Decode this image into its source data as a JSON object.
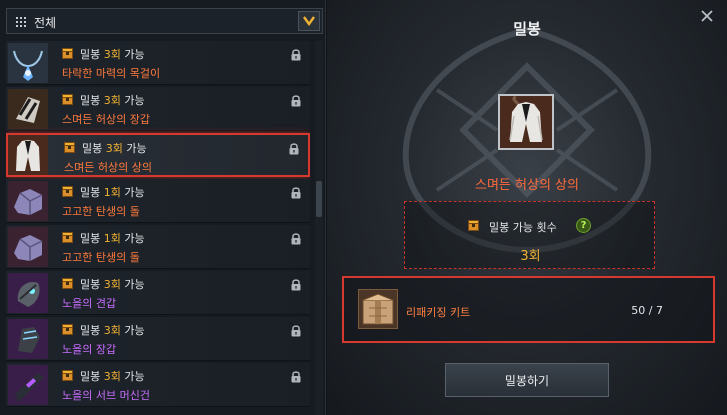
{
  "filter": {
    "label": "전체",
    "icon": "grid-icon",
    "dropdown_icon": "chevron-down-icon",
    "accent": "#f0b232"
  },
  "list": {
    "items": [
      {
        "prefix": "밀봉 ",
        "count": "3회",
        "suffix": " 가능",
        "name": "타락한 마력의 목걸이",
        "name_color": "#ff7a3c",
        "icon": "necklace-icon",
        "selected": false
      },
      {
        "prefix": "밀봉 ",
        "count": "3회",
        "suffix": " 가능",
        "name": "스며든 허상의 장갑",
        "name_color": "#ff7a3c",
        "icon": "gauntlet-icon",
        "selected": false
      },
      {
        "prefix": "밀봉 ",
        "count": "3회",
        "suffix": " 가능",
        "name": "스며든 허상의 상의",
        "name_color": "#ff7a3c",
        "icon": "coat-icon",
        "selected": true
      },
      {
        "prefix": "밀봉 ",
        "count": "1회",
        "suffix": " 가능",
        "name": "고고한 탄생의 돌",
        "name_color": "#ff7a3c",
        "icon": "stone-icon",
        "selected": false
      },
      {
        "prefix": "밀봉 ",
        "count": "1회",
        "suffix": " 가능",
        "name": "고고한 탄생의 돌",
        "name_color": "#ff7a3c",
        "icon": "stone-icon",
        "selected": false
      },
      {
        "prefix": "밀봉 ",
        "count": "3회",
        "suffix": " 가능",
        "name": "노을의 견갑",
        "name_color": "#c86cff",
        "icon": "pauldron-icon",
        "selected": false
      },
      {
        "prefix": "밀봉 ",
        "count": "3회",
        "suffix": " 가능",
        "name": "노을의 장갑",
        "name_color": "#c86cff",
        "icon": "glove-icon",
        "selected": false
      },
      {
        "prefix": "밀봉 ",
        "count": "3회",
        "suffix": " 가능",
        "name": "노을의 서브 머신건",
        "name_color": "#c86cff",
        "icon": "smg-icon",
        "selected": false
      }
    ]
  },
  "detail": {
    "title": "밀봉",
    "item_name": "스며든 허상의 상의",
    "count_label": "밀봉 가능 횟수",
    "help": "?",
    "count_value": "3회",
    "material": {
      "name": "리패키징 키트",
      "count": "50 / 7",
      "icon": "repackaging-kit-icon"
    },
    "action_label": "밀봉하기"
  },
  "colors": {
    "highlight": "#d63a2e",
    "gold": "#f0b232",
    "orange": "#ff7a3c",
    "purple": "#c86cff"
  }
}
